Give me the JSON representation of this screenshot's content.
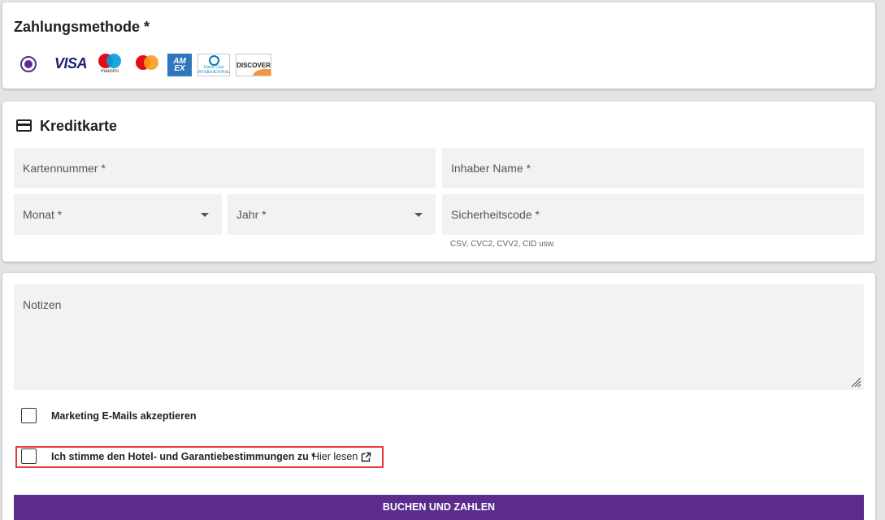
{
  "payment": {
    "title": "Zahlungsmethode *",
    "logos": {
      "visa": "VISA",
      "maestro": "maestro",
      "amex": "AM EX",
      "diners": "Diners Club INTERNATIONAL",
      "discover": "DISCOVER"
    }
  },
  "credit_card": {
    "title": "Kreditkarte",
    "fields": {
      "card_number": "Kartennummer *",
      "holder_name": "Inhaber Name *",
      "month": "Monat *",
      "year": "Jahr *",
      "security_code": "Sicherheitscode *"
    },
    "security_hint": "CSV, CVC2, CVV2, CID usw."
  },
  "notes": {
    "placeholder": "Notizen",
    "marketing_label": "Marketing E-Mails akzeptieren",
    "terms_label": "Ich stimme den Hotel- und Garantiebestimmungen zu *",
    "read_link": "Hier lesen",
    "submit_label": "BUCHEN UND ZAHLEN"
  },
  "colors": {
    "primary": "#5b2c8e",
    "highlight": "#e53935",
    "field_bg": "#f2f2f2"
  },
  "icons": [
    "credit-card-icon",
    "radio-selected-icon",
    "chevron-down-icon",
    "resize-handle-icon",
    "external-link-icon"
  ]
}
